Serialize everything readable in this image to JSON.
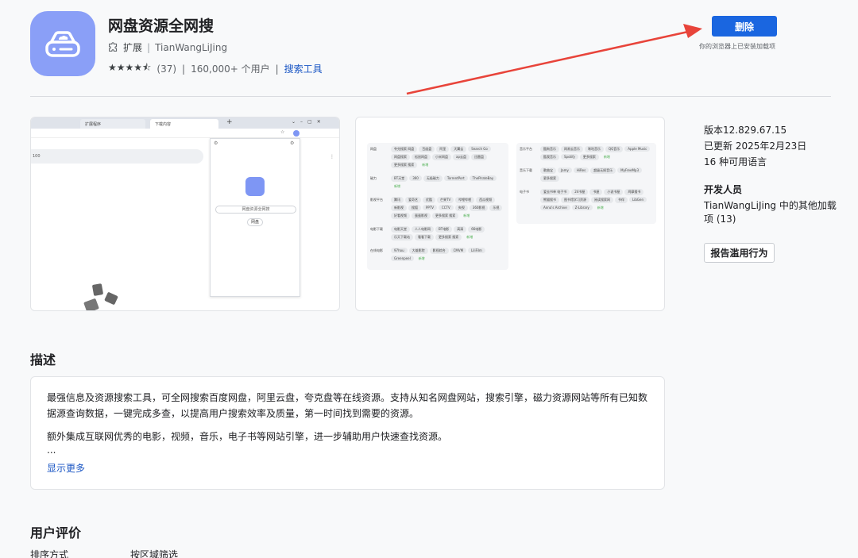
{
  "header": {
    "title": "网盘资源全网搜",
    "type_label": "扩展",
    "separator": "|",
    "author": "TianWangLiJing",
    "stars": "★★★★⯪",
    "rating": 4.5,
    "rating_count": "(37)",
    "users": "160,000+ 个用户",
    "category": "搜索工具",
    "remove_label": "删除",
    "installed_note": "你的浏览器上已安装加载项"
  },
  "screenshot1": {
    "tab1": "扩展程序",
    "tab2": "下载内容",
    "row_text": "100",
    "popup_input": "网盘资源全网搜",
    "popup_button": "网盘"
  },
  "screenshot2": {
    "left": [
      {
        "label": "网盘",
        "chips": [
          "夸克搜索 网盘",
          "百度盘",
          "阿里",
          "天翼云",
          "Search Go",
          "网盘搜索",
          "松鼠网盘",
          "小米网盘",
          "ap云盘",
          "迅雷盘",
          "更多搜索 搜索"
        ],
        "tail": "新增"
      },
      {
        "label": "磁力",
        "chips": [
          "BT天堂",
          "360",
          "无极磁力",
          "TorrentPort",
          "ThePirateBay"
        ],
        "tail": "新增"
      },
      {
        "label": "影视平台",
        "chips": [
          "腾讯",
          "爱奇艺",
          "优酷",
          "芒果TV",
          "哔哩哔哩",
          "西瓜视频",
          "新影视",
          "搜狐",
          "PPTV",
          "CCTV",
          "央视",
          "360影视",
          "乐视",
          "好看视频",
          "蛋蛋影视",
          "更多搜索 搜索"
        ],
        "tail": "新增"
      },
      {
        "label": "电影下载",
        "chips": [
          "电影天堂",
          "人人电影网",
          "BT电影",
          "高清",
          "66电影",
          "乐天下载站",
          "看看下载",
          "更多搜索 搜索"
        ],
        "tail": "新增"
      },
      {
        "label": "在线电影",
        "chips": [
          "97hou",
          "大雄影院",
          "影视综合",
          "CMVM",
          "LiliFilm",
          "Greenpeel"
        ],
        "tail": "新增"
      }
    ],
    "right": [
      {
        "label": "音乐平台",
        "chips": [
          "酷狗音乐",
          "网易云音乐",
          "咪咕音乐",
          "QQ音乐",
          "Apple Music",
          "酷我音乐",
          "Spotify",
          "更多搜索"
        ],
        "tail": "新增"
      },
      {
        "label": "音乐下载",
        "chips": [
          "歌曲宝",
          "Jamy",
          "HiRes",
          "超级无损音乐",
          "MyFreeMp3",
          "更多搜索"
        ],
        "tail": ""
      },
      {
        "label": "电子书",
        "chips": [
          "爱去书单 电子书",
          "24书屋",
          "书屋",
          "小说书屋",
          "鸠摩搜书",
          "熊猫搜书",
          "图书馆学习资源",
          "阅读搜索网",
          "书伴",
          "LibGen",
          "Anna's Archive",
          "Z-Library"
        ],
        "tail": "新增"
      }
    ]
  },
  "info": {
    "version": "版本12.829.67.15",
    "updated": "已更新 2025年2月23日",
    "languages": "16 种可用语言",
    "developer_heading": "开发人员",
    "developer_link_1": "TianWangLiJing 中的其他加载",
    "developer_link_2": "项 (13)",
    "report_label": "报告滥用行为"
  },
  "description": {
    "heading": "描述",
    "p1": "最强信息及资源搜索工具，可全网搜索百度网盘，阿里云盘，夸克盘等在线资源。支持从知名网盘网站，搜索引擎，磁力资源网站等所有已知数据源查询数据，一键完成多查，以提高用户搜索效率及质量，第一时间找到需要的资源。",
    "p2": "额外集成互联网优秀的电影，视频，音乐，电子书等网站引擎，进一步辅助用户快速查找资源。",
    "ellipsis": "...",
    "show_more": "显示更多"
  },
  "reviews": {
    "heading": "用户评价",
    "sort_label": "排序方式",
    "filter_label": "按区域筛选"
  },
  "colors": {
    "accent": "#1a66e0",
    "icon_bg": "#8a9ff7",
    "arrow": "#e8443a",
    "link": "#1a56c4"
  }
}
